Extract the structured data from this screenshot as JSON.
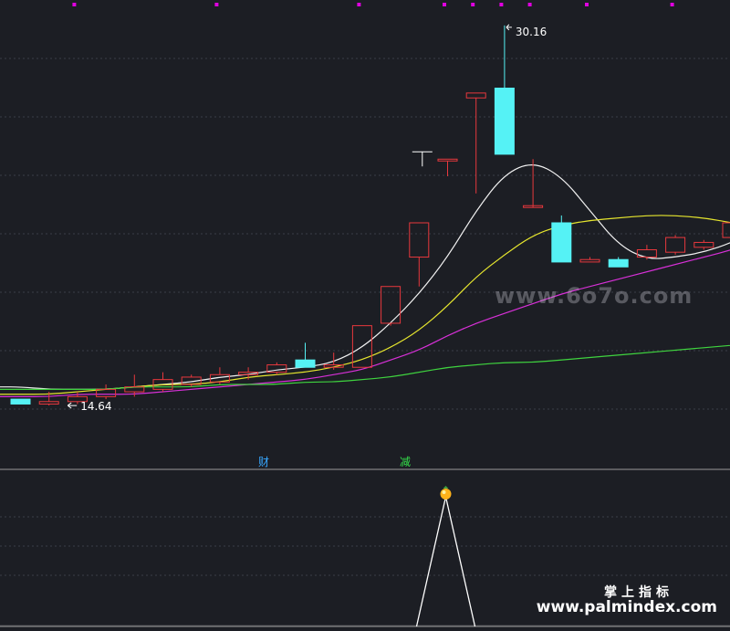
{
  "colors": {
    "background": "#1c1e24",
    "grid": "#3a3d47",
    "divider": "#9a9a9a",
    "candle_up": "#e8383d",
    "candle_down": "#55f2f5",
    "ma_white": "#f2f2f2",
    "ma_yellow": "#e6e62e",
    "ma_magenta": "#d830d8",
    "ma_green": "#3fd43f",
    "marker": "#e000e0",
    "badge_cai": "#38a8ff",
    "badge_jian": "#35e04a",
    "signal_line": "#ffffff",
    "signal_ball": "#ffb21a"
  },
  "chart_data": [
    {
      "type": "candlestick",
      "ylim": [
        13.3,
        30.9
      ],
      "grid": true,
      "candles": [
        {
          "open": 14.9,
          "close": 14.7,
          "high": 14.9,
          "low": 14.7
        },
        {
          "open": 14.7,
          "close": 14.8,
          "high": 15.2,
          "low": 14.64
        },
        {
          "open": 14.8,
          "close": 15.0,
          "high": 15.2,
          "low": 14.7
        },
        {
          "open": 15.0,
          "close": 15.3,
          "high": 15.5,
          "low": 14.9
        },
        {
          "open": 15.2,
          "close": 15.4,
          "high": 15.9,
          "low": 15.0
        },
        {
          "open": 15.3,
          "close": 15.7,
          "high": 16.0,
          "low": 15.2
        },
        {
          "open": 15.5,
          "close": 15.8,
          "high": 15.9,
          "low": 15.4
        },
        {
          "open": 15.6,
          "close": 15.9,
          "high": 16.2,
          "low": 15.5
        },
        {
          "open": 15.9,
          "close": 16.0,
          "high": 16.2,
          "low": 15.7
        },
        {
          "open": 16.0,
          "close": 16.3,
          "high": 16.4,
          "low": 15.9
        },
        {
          "open": 16.5,
          "close": 16.2,
          "high": 17.2,
          "low": 16.2
        },
        {
          "open": 16.2,
          "close": 16.3,
          "high": 16.8,
          "low": 16.1
        },
        {
          "open": 16.2,
          "close": 17.9,
          "high": 17.9,
          "low": 16.2
        },
        {
          "open": 18.0,
          "close": 19.5,
          "high": 19.5,
          "low": 17.9
        },
        {
          "open": 20.7,
          "close": 22.1,
          "high": 22.1,
          "low": 19.5
        },
        {
          "open": 24.7,
          "close": 24.7,
          "high": 24.7,
          "low": 24.0
        },
        {
          "open": 27.2,
          "close": 27.4,
          "high": 27.4,
          "low": 23.3
        },
        {
          "open": 27.6,
          "close": 24.9,
          "high": 30.16,
          "low": 24.9
        },
        {
          "open": 22.8,
          "close": 22.8,
          "high": 24.7,
          "low": 22.8
        },
        {
          "open": 22.1,
          "close": 20.5,
          "high": 22.4,
          "low": 20.5
        },
        {
          "open": 20.5,
          "close": 20.6,
          "high": 20.7,
          "low": 20.5
        },
        {
          "open": 20.6,
          "close": 20.3,
          "high": 20.7,
          "low": 20.3
        },
        {
          "open": 20.7,
          "close": 21.0,
          "high": 21.2,
          "low": 20.6
        },
        {
          "open": 20.9,
          "close": 21.5,
          "high": 21.6,
          "low": 20.8
        },
        {
          "open": 21.1,
          "close": 21.3,
          "high": 21.4,
          "low": 21.0
        },
        {
          "open": 21.5,
          "close": 22.1,
          "high": 22.5,
          "low": 21.3
        },
        {
          "open": 21.8,
          "close": 22.9,
          "high": 23.3,
          "low": 21.6
        }
      ],
      "annotations": {
        "high_label": "30.16",
        "low_label": "14.64",
        "t_marker_value": 25.0
      },
      "moving_averages": [
        {
          "color_key": "ma_white",
          "values": [
            15.4,
            15.3,
            15.3,
            15.3,
            15.4,
            15.5,
            15.6,
            15.8,
            15.9,
            16.1,
            16.2,
            16.4,
            17.0,
            18.0,
            19.2,
            20.7,
            22.6,
            24.1,
            24.6,
            24.0,
            22.6,
            21.2,
            20.6,
            20.7,
            20.9,
            21.3,
            21.9
          ]
        },
        {
          "color_key": "ma_yellow",
          "values": [
            15.1,
            15.1,
            15.2,
            15.3,
            15.4,
            15.5,
            15.5,
            15.6,
            15.8,
            15.9,
            16.0,
            16.2,
            16.5,
            17.0,
            17.7,
            18.7,
            19.9,
            20.8,
            21.6,
            22.0,
            22.2,
            22.3,
            22.4,
            22.4,
            22.3,
            22.1,
            21.9
          ]
        },
        {
          "color_key": "ma_magenta",
          "values": [
            15.0,
            15.0,
            15.1,
            15.1,
            15.1,
            15.2,
            15.3,
            15.4,
            15.5,
            15.6,
            15.7,
            15.9,
            16.1,
            16.5,
            16.9,
            17.5,
            18.0,
            18.4,
            18.8,
            19.2,
            19.5,
            19.8,
            20.1,
            20.4,
            20.7,
            21.0,
            21.4
          ]
        },
        {
          "color_key": "ma_green",
          "values": [
            15.3,
            15.3,
            15.3,
            15.3,
            15.4,
            15.4,
            15.4,
            15.5,
            15.5,
            15.5,
            15.6,
            15.6,
            15.7,
            15.8,
            16.0,
            16.2,
            16.3,
            16.4,
            16.4,
            16.5,
            16.6,
            16.7,
            16.8,
            16.9,
            17.0,
            17.1,
            17.2
          ]
        }
      ],
      "top_markers": [
        2,
        7,
        12,
        15,
        16,
        17,
        18,
        20,
        23
      ]
    },
    {
      "type": "line",
      "ylim": [
        0,
        1
      ],
      "grid": true,
      "values": [
        0,
        0,
        0,
        0,
        0,
        0,
        0,
        0,
        0,
        0,
        0,
        0,
        0,
        0,
        0,
        1,
        0,
        0,
        0,
        0,
        0,
        0,
        0,
        0,
        0,
        0,
        0
      ],
      "signal_index": 15
    }
  ],
  "badges": {
    "cai": "财",
    "jian": "减"
  },
  "brand": {
    "cn": "掌上指标",
    "url": "www.palmindex.com",
    "watermark": "www.6o7o.com"
  }
}
